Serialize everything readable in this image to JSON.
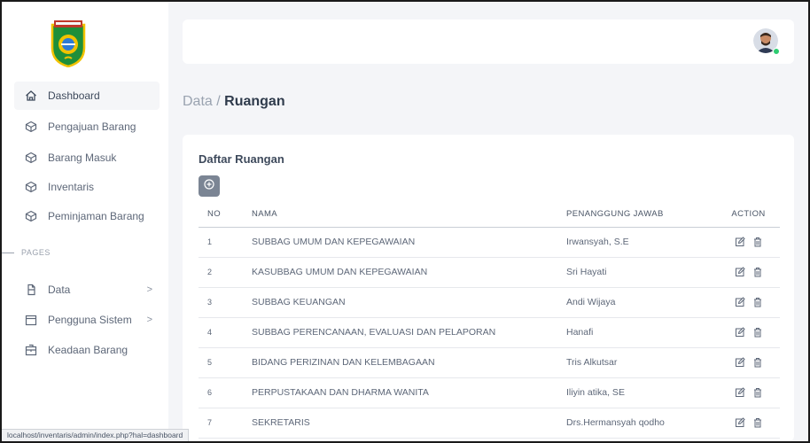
{
  "sidebar": {
    "items": [
      {
        "label": "Dashboard",
        "icon": "home-icon"
      },
      {
        "label": "Pengajuan Barang",
        "icon": "box-icon"
      },
      {
        "label": "Barang Masuk",
        "icon": "box-icon"
      },
      {
        "label": "Inventaris",
        "icon": "box-icon"
      },
      {
        "label": "Peminjaman Barang",
        "icon": "box-icon"
      }
    ],
    "section_label": "PAGES",
    "pages": [
      {
        "label": "Data",
        "icon": "file-icon",
        "chevron": ">"
      },
      {
        "label": "Pengguna Sistem",
        "icon": "calendar-icon",
        "chevron": ">"
      },
      {
        "label": "Keadaan Barang",
        "icon": "package-icon"
      }
    ]
  },
  "breadcrumb": {
    "parent": "Data / ",
    "current": "Ruangan"
  },
  "card": {
    "title": "Daftar Ruangan",
    "add_icon": "plus-circle-icon"
  },
  "table": {
    "headers": {
      "no": "NO",
      "nama": "NAMA",
      "pj": "PENANGGUNG JAWAB",
      "action": "ACTION"
    },
    "rows": [
      {
        "no": "1",
        "nama": "SUBBAG UMUM DAN KEPEGAWAIAN",
        "pj": "Irwansyah, S.E"
      },
      {
        "no": "2",
        "nama": "KASUBBAG UMUM DAN KEPEGAWAIAN",
        "pj": "Sri Hayati"
      },
      {
        "no": "3",
        "nama": "SUBBAG KEUANGAN",
        "pj": "Andi Wijaya"
      },
      {
        "no": "4",
        "nama": "SUBBAG PERENCANAAN, EVALUASI DAN PELAPORAN",
        "pj": "Hanafi"
      },
      {
        "no": "5",
        "nama": "BIDANG PERIZINAN DAN KELEMBAGAAN",
        "pj": "Tris Alkutsar"
      },
      {
        "no": "6",
        "nama": "PERPUSTAKAAN DAN DHARMA WANITA",
        "pj": "Iliyin atika, SE"
      },
      {
        "no": "7",
        "nama": "SEKRETARIS",
        "pj": "Drs.Hermansyah qodho"
      }
    ]
  },
  "statusbar": {
    "url": "localhost/inventaris/admin/index.php?hal=dashboard"
  },
  "colors": {
    "accent": "#7b8594",
    "online": "#2ecc71"
  }
}
